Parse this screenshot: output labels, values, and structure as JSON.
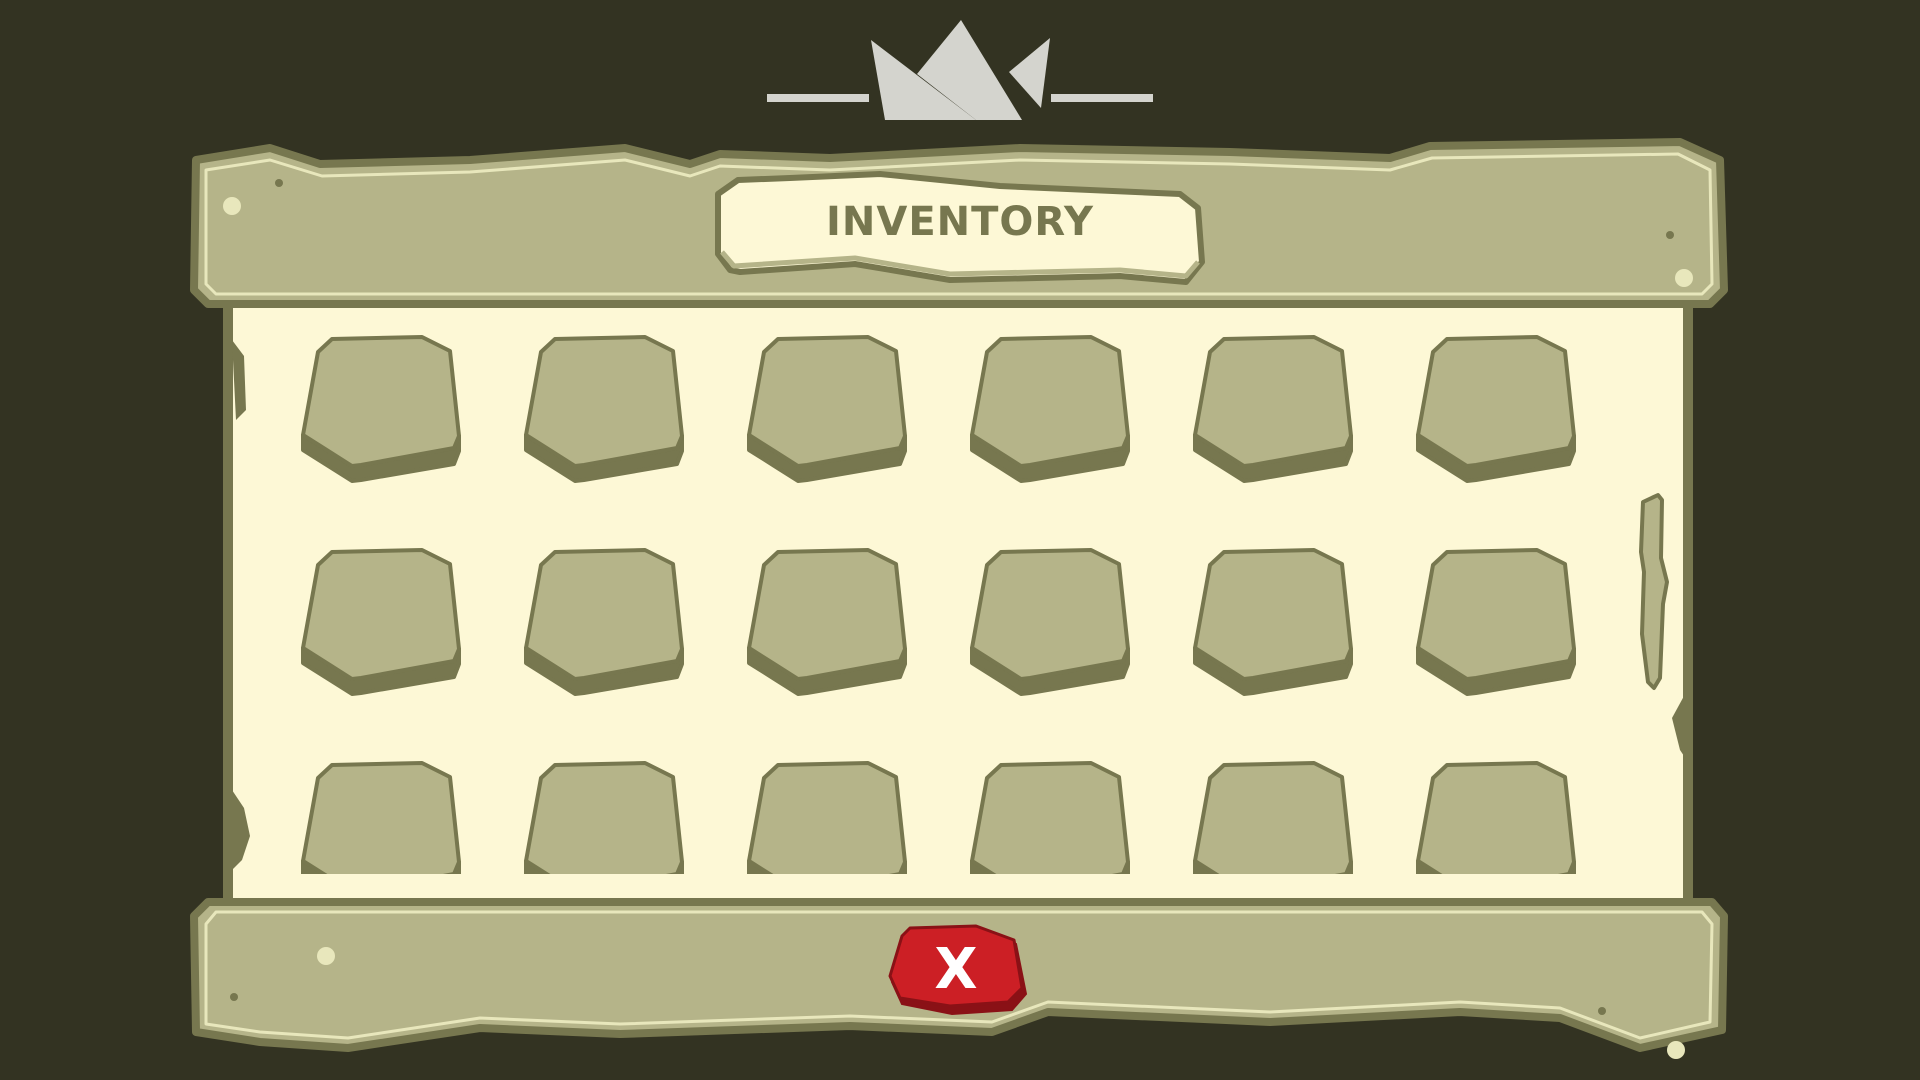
{
  "window": {
    "title": "INVENTORY"
  },
  "inventory": {
    "columns": 6,
    "visible_rows": 3,
    "slots_visible": 18,
    "slots_empty": true
  },
  "close_button": {
    "label": "X",
    "icon": "close-icon"
  },
  "decorations": {
    "crown_icon": "crown-icon"
  },
  "colors": {
    "background": "#333322",
    "panel": "#b5b489",
    "panel_outline": "#77774f",
    "panel_highlight": "#e8e7bc",
    "content_area": "#fdf8d6",
    "slot_fill": "#b5b489",
    "slot_shadow": "#77774f",
    "crown": "#d4d4ce",
    "close_button": "#cc1f25",
    "close_button_shadow": "#8a1116",
    "close_label": "#ffffff"
  }
}
